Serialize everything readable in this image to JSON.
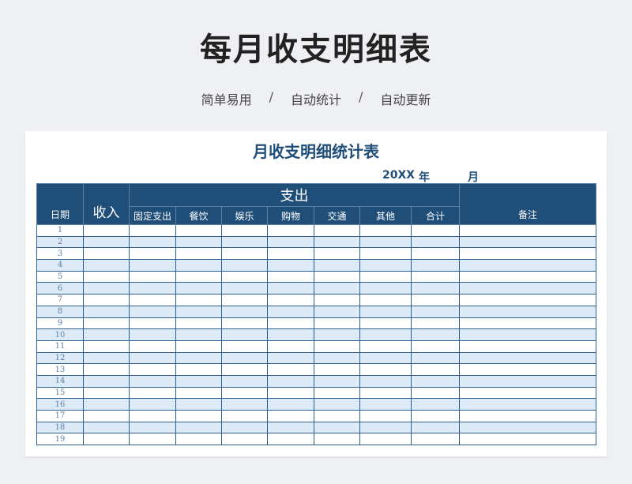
{
  "header": {
    "title": "每月收支明细表",
    "tagline": [
      "简单易用",
      "自动统计",
      "自动更新"
    ],
    "separator": "/"
  },
  "sheet": {
    "title": "月收支明细统计表",
    "year": "20XX",
    "year_label": "年",
    "month_label": "月"
  },
  "table": {
    "date_header": "日期",
    "income_header": "收入",
    "expense_header": "支出",
    "expense_columns": [
      "固定支出",
      "餐饮",
      "娱乐",
      "购物",
      "交通",
      "其他",
      "合计"
    ],
    "note_header": "备注",
    "rows": [
      "1",
      "2",
      "3",
      "4",
      "5",
      "6",
      "7",
      "8",
      "9",
      "10",
      "11",
      "12",
      "13",
      "14",
      "15",
      "16",
      "17",
      "18",
      "19"
    ]
  },
  "colors": {
    "header_bg": "#1f4e79",
    "title_blue": "#1f4e79",
    "row_alt": "#ddeaf7",
    "page_bg": "#eef0f3"
  }
}
